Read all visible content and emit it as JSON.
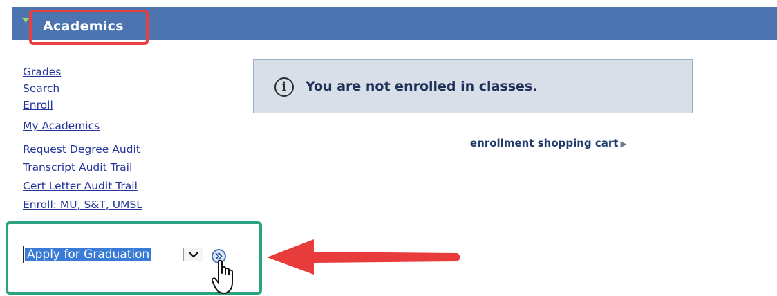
{
  "header": {
    "title": "Academics"
  },
  "nav": {
    "links": [
      {
        "label": "Grades"
      },
      {
        "label": "Search"
      },
      {
        "label": "Enroll"
      },
      {
        "label": "My Academics"
      },
      {
        "label": "Request Degree Audit"
      },
      {
        "label": "Transcript Audit Trail"
      },
      {
        "label": "Cert Letter Audit Trail"
      },
      {
        "label": "Enroll: MU, S&T, UMSL"
      }
    ]
  },
  "message": {
    "text": "You are not enrolled in classes."
  },
  "cart_link": {
    "label": "enrollment shopping cart"
  },
  "action_select": {
    "selected": "Apply for Graduation"
  },
  "colors": {
    "header_bar": "#4b74b0",
    "highlight_red": "#e8403f",
    "highlight_green": "#2aa381",
    "link_blue": "#23359a"
  },
  "icons": [
    "expand-triangle-icon",
    "info-icon",
    "play-arrow-icon",
    "chevron-down-icon",
    "double-chevron-right-icon",
    "hand-cursor-icon",
    "red-arrow-icon"
  ]
}
